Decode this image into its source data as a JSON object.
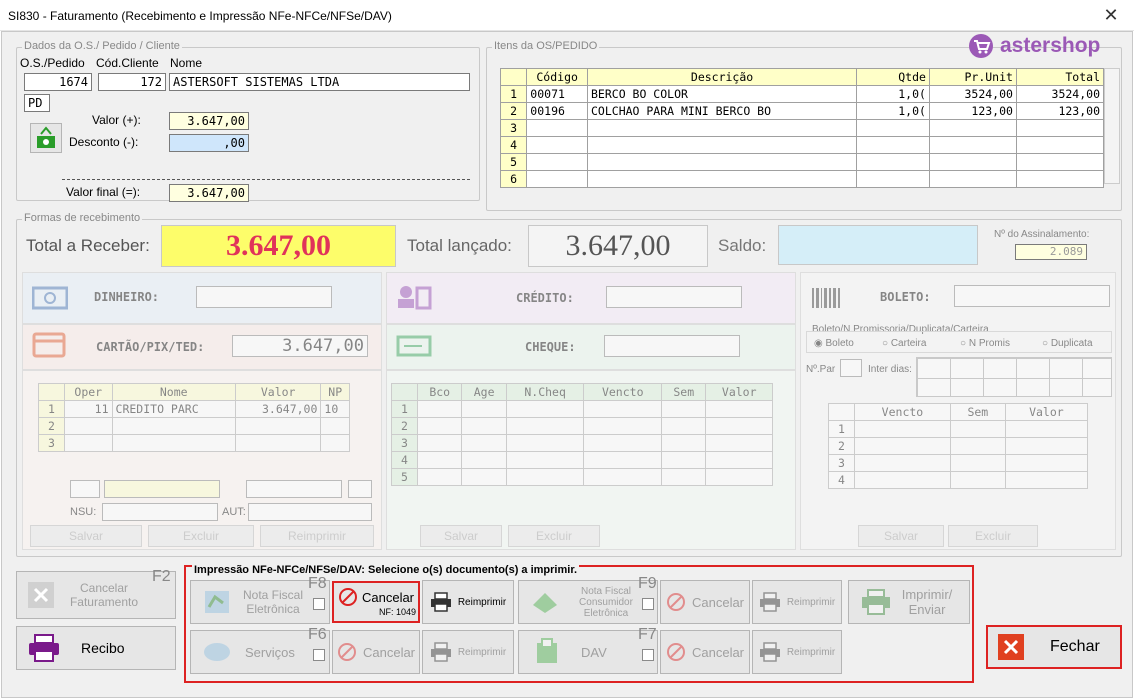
{
  "window": {
    "title": "SI830 - Faturamento (Recebimento e Impressão NFe-NFCe/NFSe/DAV)",
    "close": "✕"
  },
  "brand": {
    "name": "astershop",
    "color": "#9b59b6"
  },
  "dados": {
    "legend": "Dados da O.S./ Pedido / Cliente",
    "col_os": "O.S./Pedido",
    "col_cod": "Cód.Cliente",
    "col_nome": "Nome",
    "os": "1674",
    "cod": "172",
    "nome": "ASTERSOFT SISTEMAS LTDA",
    "tipo": "PD",
    "valor_label": "Valor (+):",
    "valor": "3.647,00",
    "desconto_label": "Desconto (-):",
    "desconto": ",00",
    "final_label": "Valor final (=):",
    "final": "3.647,00"
  },
  "itens": {
    "legend": "Itens da OS/PEDIDO",
    "headers": [
      "Código",
      "Descrição",
      "Qtde",
      "Pr.Unit",
      "Total"
    ],
    "rows": [
      [
        "1",
        "00071",
        "BERCO BO COLOR",
        "1,0(",
        "3524,00",
        "3524,00"
      ],
      [
        "2",
        "00196",
        "COLCHAO PARA MINI BERCO BO",
        "1,0(",
        "123,00",
        "123,00"
      ],
      [
        "3",
        "",
        "",
        "",
        "",
        ""
      ],
      [
        "4",
        "",
        "",
        "",
        "",
        ""
      ],
      [
        "5",
        "",
        "",
        "",
        "",
        ""
      ],
      [
        "6",
        "",
        "",
        "",
        "",
        ""
      ]
    ]
  },
  "formas": {
    "legend": "Formas de recebimento",
    "total_receber_label": "Total a Receber:",
    "total_receber": "3.647,00",
    "total_lancado_label": "Total lançado:",
    "total_lancado": "3.647,00",
    "saldo_label": "Saldo:",
    "saldo": "",
    "assinalamento_label": "Nº do Assinalamento:",
    "assinalamento": "2.089",
    "dinheiro": "DINHEIRO:",
    "credito": "CRÉDITO:",
    "boleto": "BOLETO:",
    "cartao": "CARTÃO/PIX/TED:",
    "cartao_valor": "3.647,00",
    "cheque": "CHEQUE:",
    "cartao_grid": {
      "headers": [
        "Oper",
        "Nome",
        "Valor",
        "NP"
      ],
      "rows": [
        [
          "1",
          "11",
          "CREDITO PARC",
          "3.647,00",
          "10"
        ],
        [
          "2",
          "",
          "",
          "",
          ""
        ],
        [
          "3",
          "",
          "",
          "",
          ""
        ]
      ]
    },
    "cheque_grid": {
      "headers": [
        "Bco",
        "Age",
        "N.Cheq",
        "Vencto",
        "Sem",
        "Valor"
      ],
      "rows": [
        "1",
        "2",
        "3",
        "4",
        "5"
      ]
    },
    "boleto_group": "Boleto/N.Promissoria/Duplicata/Carteira",
    "radios": [
      "Boleto",
      "Carteira",
      "N Promis",
      "Duplicata"
    ],
    "npar": "Nº.Par",
    "interdias": "Inter dias:",
    "boleto_grid": {
      "headers": [
        "Vencto",
        "Sem",
        "Valor"
      ],
      "rows": [
        "1",
        "2",
        "3",
        "4"
      ]
    },
    "nsu": "NSU:",
    "aut": "AUT:",
    "salvar": "Salvar",
    "excluir": "Excluir",
    "reimprimir": "Reimprimir"
  },
  "impressao": {
    "legend": "Impressão NFe-NFCe/NFSe/DAV: Selecione o(s) documento(s) a imprimir.",
    "nfe": "Nota Fiscal Eletrônica",
    "nfe_key": "F8",
    "cancelar": "Cancelar",
    "nf_label": "NF:",
    "nf_num": "1049",
    "reimprimir": "Reimprimir",
    "nfce": "Nota Fiscal Consumidor Eletrônica",
    "nfce_key": "F9",
    "imprimir_enviar": "Imprimir/ Enviar",
    "servicos": "Serviços",
    "servicos_key": "F6",
    "dav": "DAV",
    "dav_key": "F7"
  },
  "left_buttons": {
    "cancelar_fat": "Cancelar Faturamento",
    "cancelar_key": "F2",
    "recibo": "Recibo"
  },
  "fechar": "Fechar"
}
